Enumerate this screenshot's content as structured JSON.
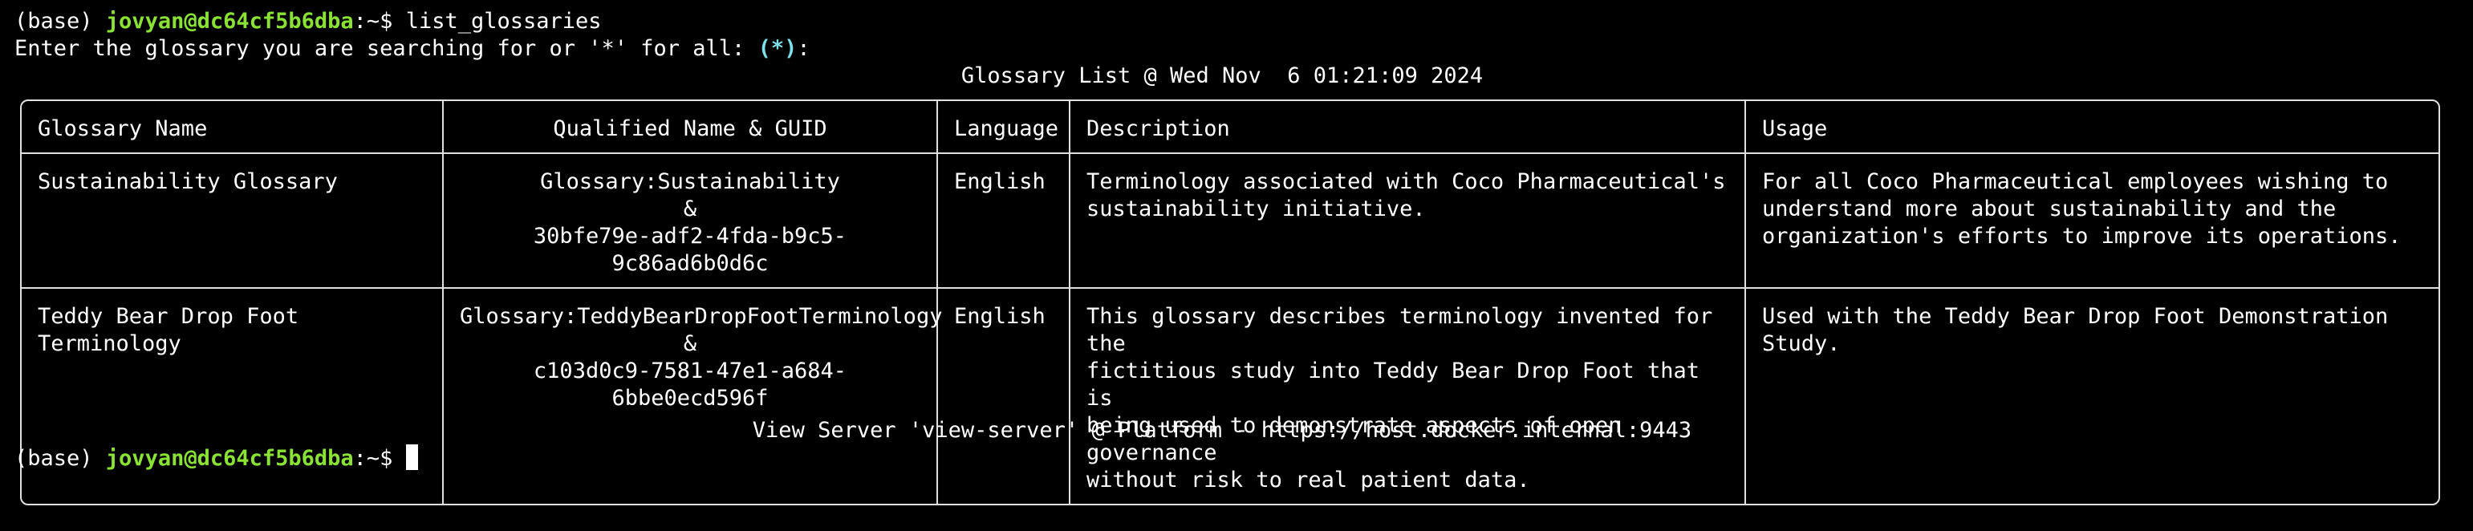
{
  "terminal": {
    "prompt_env": "(base) ",
    "prompt_user_host": "jovyan@dc64cf5b6dba",
    "prompt_path": ":~$ ",
    "command": "list_glossaries",
    "input_prompt": "Enter the glossary you are searching for or '*' for all: ",
    "input_default": "(*)",
    "input_suffix": ":",
    "table_title": "Glossary List @ Wed Nov  6 01:21:09 2024",
    "footer": "View Server 'view-server' @ Platform - https://host.docker.internal:9443"
  },
  "table": {
    "headers": [
      "Glossary Name",
      "Qualified Name & GUID",
      "Language",
      "Description",
      "Usage"
    ],
    "rows": [
      {
        "name": "Sustainability Glossary",
        "qualified": "Glossary:Sustainability\n&\n30bfe79e-adf2-4fda-b9c5-9c86ad6b0d6c",
        "language": "English",
        "description": "Terminology associated with Coco Pharmaceutical's\nsustainability initiative.",
        "usage": "For all Coco Pharmaceutical employees wishing to\nunderstand more about sustainability and the\norganization's efforts to improve its operations."
      },
      {
        "name": "Teddy Bear Drop Foot Terminology",
        "qualified": "Glossary:TeddyBearDropFootTerminology\n&\nc103d0c9-7581-47e1-a684-6bbe0ecd596f",
        "language": "English",
        "description": "This glossary describes terminology invented for the\nfictitious study into Teddy Bear Drop Foot that is\nbeing used to demonstrate aspects of open governance\nwithout risk to real patient data.",
        "usage": "Used with the Teddy Bear Drop Foot Demonstration\nStudy."
      }
    ]
  },
  "colors": {
    "background": "#000000",
    "text": "#ffffff",
    "prompt_user": "#8ae234",
    "default_value": "#7ee0e8"
  }
}
